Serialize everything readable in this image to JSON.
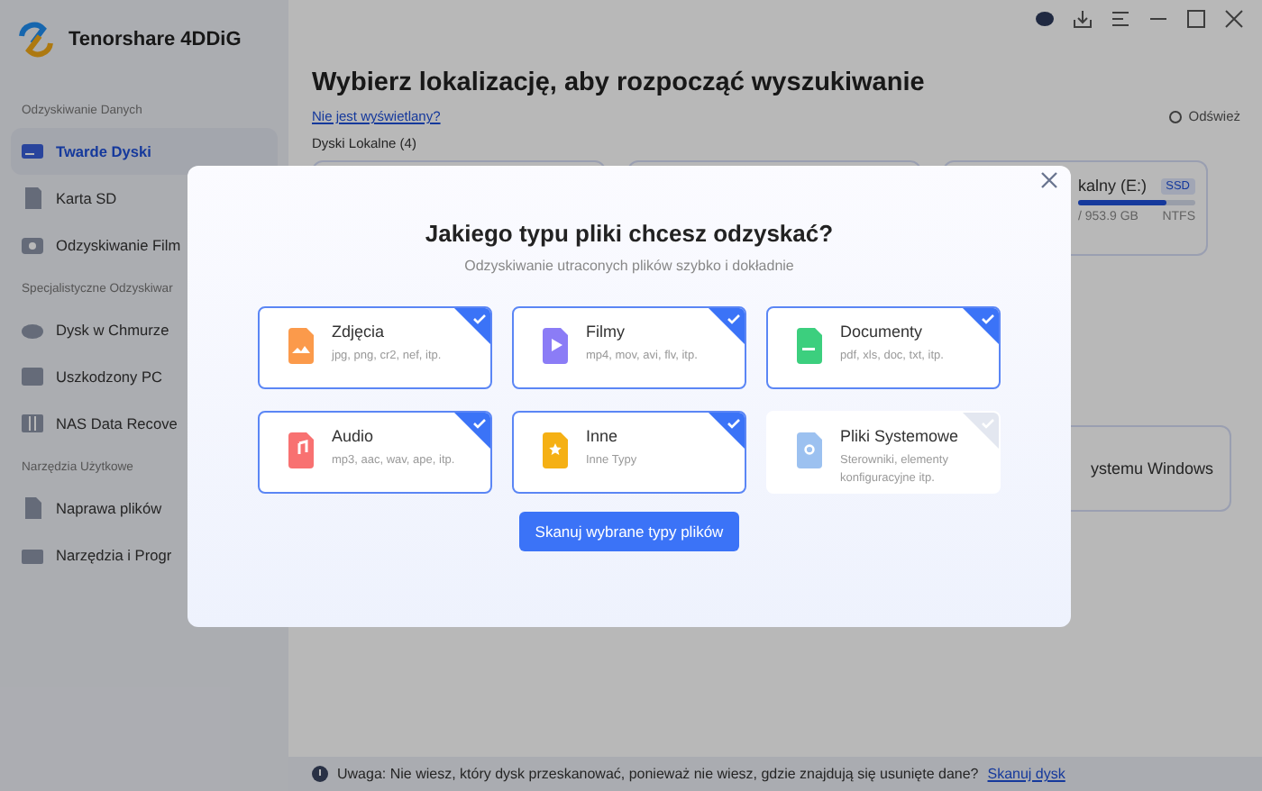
{
  "app": {
    "name": "Tenorshare 4DDiG"
  },
  "sidebar": {
    "sections": [
      {
        "title": "Odzyskiwanie Danych",
        "items": [
          {
            "label": "Twarde Dyski",
            "kind": "drive",
            "selected": true
          },
          {
            "label": "Karta SD",
            "kind": "sd",
            "selected": false
          },
          {
            "label": "Odzyskiwanie Film",
            "kind": "camera",
            "selected": false
          }
        ]
      },
      {
        "title": "Specjalistyczne Odzyskiwar",
        "items": [
          {
            "label": "Dysk w Chmurze",
            "kind": "cloud",
            "selected": false
          },
          {
            "label": "Uszkodzony PC",
            "kind": "pc",
            "selected": false
          },
          {
            "label": "NAS Data Recove",
            "kind": "nas",
            "selected": false
          }
        ]
      },
      {
        "title": "Narzędzia Użytkowe",
        "items": [
          {
            "label": "Naprawa plików",
            "kind": "file",
            "selected": false
          },
          {
            "label": "Narzędzia i Progr",
            "kind": "toolbox",
            "selected": false
          }
        ]
      }
    ]
  },
  "main": {
    "title": "Wybierz lokalizację, aby rozpocząć wyszukiwanie",
    "help_link": "Nie jest wyświetlany?",
    "refresh": "Odśwież",
    "section": "Dyski Lokalne (4)",
    "drive": {
      "name": "kalny (E:)",
      "badge": "SSD",
      "size": "/ 953.9 GB",
      "fs": "NTFS",
      "level": 0.75
    },
    "system_card": "ystemu Windows"
  },
  "dialog": {
    "title": "Jakiego typu pliki chcesz odzyskać?",
    "subtitle": "Odzyskiwanie utraconych plików szybko i dokładnie",
    "types": [
      {
        "name": "Zdjęcia",
        "desc": "jpg, png, cr2, nef, itp.",
        "kind": "image",
        "color": "#fb9a4b",
        "selected": true
      },
      {
        "name": "Filmy",
        "desc": "mp4, mov, avi, flv, itp.",
        "kind": "video",
        "color": "#8b7cf6",
        "selected": true
      },
      {
        "name": "Documenty",
        "desc": "pdf, xls, doc, txt, itp.",
        "kind": "document",
        "color": "#3ccf7e",
        "selected": true
      },
      {
        "name": "Audio",
        "desc": "mp3, aac, wav, ape, itp.",
        "kind": "audio",
        "color": "#f87171",
        "selected": true
      },
      {
        "name": "Inne",
        "desc": "Inne Typy",
        "kind": "other",
        "color": "#f5b014",
        "selected": true
      },
      {
        "name": "Pliki Systemowe",
        "desc": "Sterowniki, elementy konfiguracyjne itp.",
        "kind": "system",
        "color": "#9cc1f0",
        "selected": false
      }
    ],
    "button": "Skanuj wybrane typy plików"
  },
  "footer": {
    "text": "Uwaga: Nie wiesz, który dysk przeskanować, ponieważ nie wiesz, gdzie znajdują się usunięte dane?",
    "link": "Skanuj dysk"
  }
}
